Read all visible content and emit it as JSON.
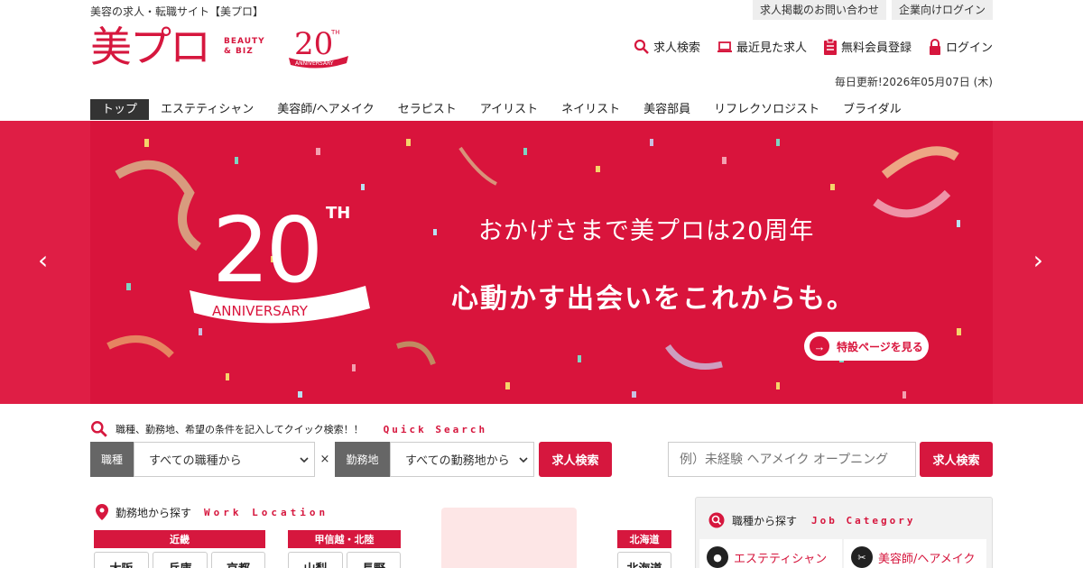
{
  "header": {
    "tagline": "美容の求人・転職サイト【美プロ】",
    "top_links": [
      "求人掲載のお問い合わせ",
      "企業向けログイン"
    ],
    "logo_text": "美プロ",
    "logo_sub_1": "BEAUTY",
    "logo_sub_2": "& BIZ",
    "logo_20": "20",
    "logo_th": "TH",
    "logo_anniv": "ANNIVERSARY",
    "nav": [
      {
        "label": "求人検索",
        "icon": "search-icon"
      },
      {
        "label": "最近見た求人",
        "icon": "laptop-icon"
      },
      {
        "label": "無料会員登録",
        "icon": "clipboard-icon"
      },
      {
        "label": "ログイン",
        "icon": "lock-icon"
      }
    ],
    "update": "毎日更新!2026年05月07日 (木)"
  },
  "tabs": [
    "トップ",
    "エステティシャン",
    "美容師/ヘアメイク",
    "セラピスト",
    "アイリスト",
    "ネイリスト",
    "美容部員",
    "リフレクソロジスト",
    "ブライダル"
  ],
  "hero": {
    "badge_number": "20",
    "badge_th": "TH",
    "badge_ribbon": "ANNIVERSARY",
    "line1": "おかげさまで美プロは20周年",
    "line2": "心動かす出会いをこれからも。",
    "button": "特設ページを見る",
    "prev": "‹",
    "next": "›"
  },
  "quick_search": {
    "title": "職種、勤務地、希望の条件を記入してクイック検索！！",
    "title_en": "Quick Search",
    "job_label": "職種",
    "job_value": "すべての職種から",
    "times": "×",
    "loc_label": "勤務地",
    "loc_value": "すべての勤務地から",
    "button": "求人検索",
    "keyword_placeholder": "例）未経験 ヘアメイク オープニング",
    "keyword_button": "求人検索"
  },
  "work_location": {
    "title": "勤務地から探す",
    "title_en": "Work Location",
    "regions": [
      {
        "name": "近畿",
        "prefs": [
          "大阪",
          "兵庫",
          "京都"
        ]
      },
      {
        "name": "甲信越・北陸",
        "prefs": [
          "山梨",
          "長野"
        ]
      },
      {
        "name": "北海道",
        "prefs": [
          "北海道"
        ]
      }
    ]
  },
  "job_category": {
    "title": "職種から探す",
    "title_en": "Job Category",
    "items": [
      "エステティシャン",
      "美容師/ヘアメイク"
    ]
  },
  "colors": {
    "accent": "#d6173e",
    "hero_bg": "#d9143c"
  }
}
